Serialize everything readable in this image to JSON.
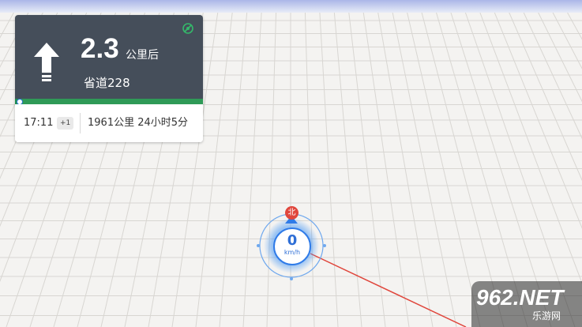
{
  "navigation": {
    "distance_value": "2.3",
    "distance_unit": "公里后",
    "road_name": "省道228",
    "progress_fraction": 0.02,
    "arrival_time": "17:11",
    "day_offset": "+1",
    "remaining": "1961公里 24小时5分",
    "turn_icon": "straight-arrow-icon",
    "gps_icon": "gps-signal-icon"
  },
  "compass": {
    "north_label": "北",
    "speed_value": "0",
    "speed_unit": "km/h"
  },
  "watermark": {
    "logo_text": "962.NET",
    "sub_text": "乐游网"
  },
  "colors": {
    "card_dark": "#454e5a",
    "progress_green": "#2f9a57",
    "compass_blue": "#2f7be8",
    "route_red": "#e0463c",
    "map_bg": "#f4f3f1",
    "grid_line": "#d8d6d2"
  }
}
